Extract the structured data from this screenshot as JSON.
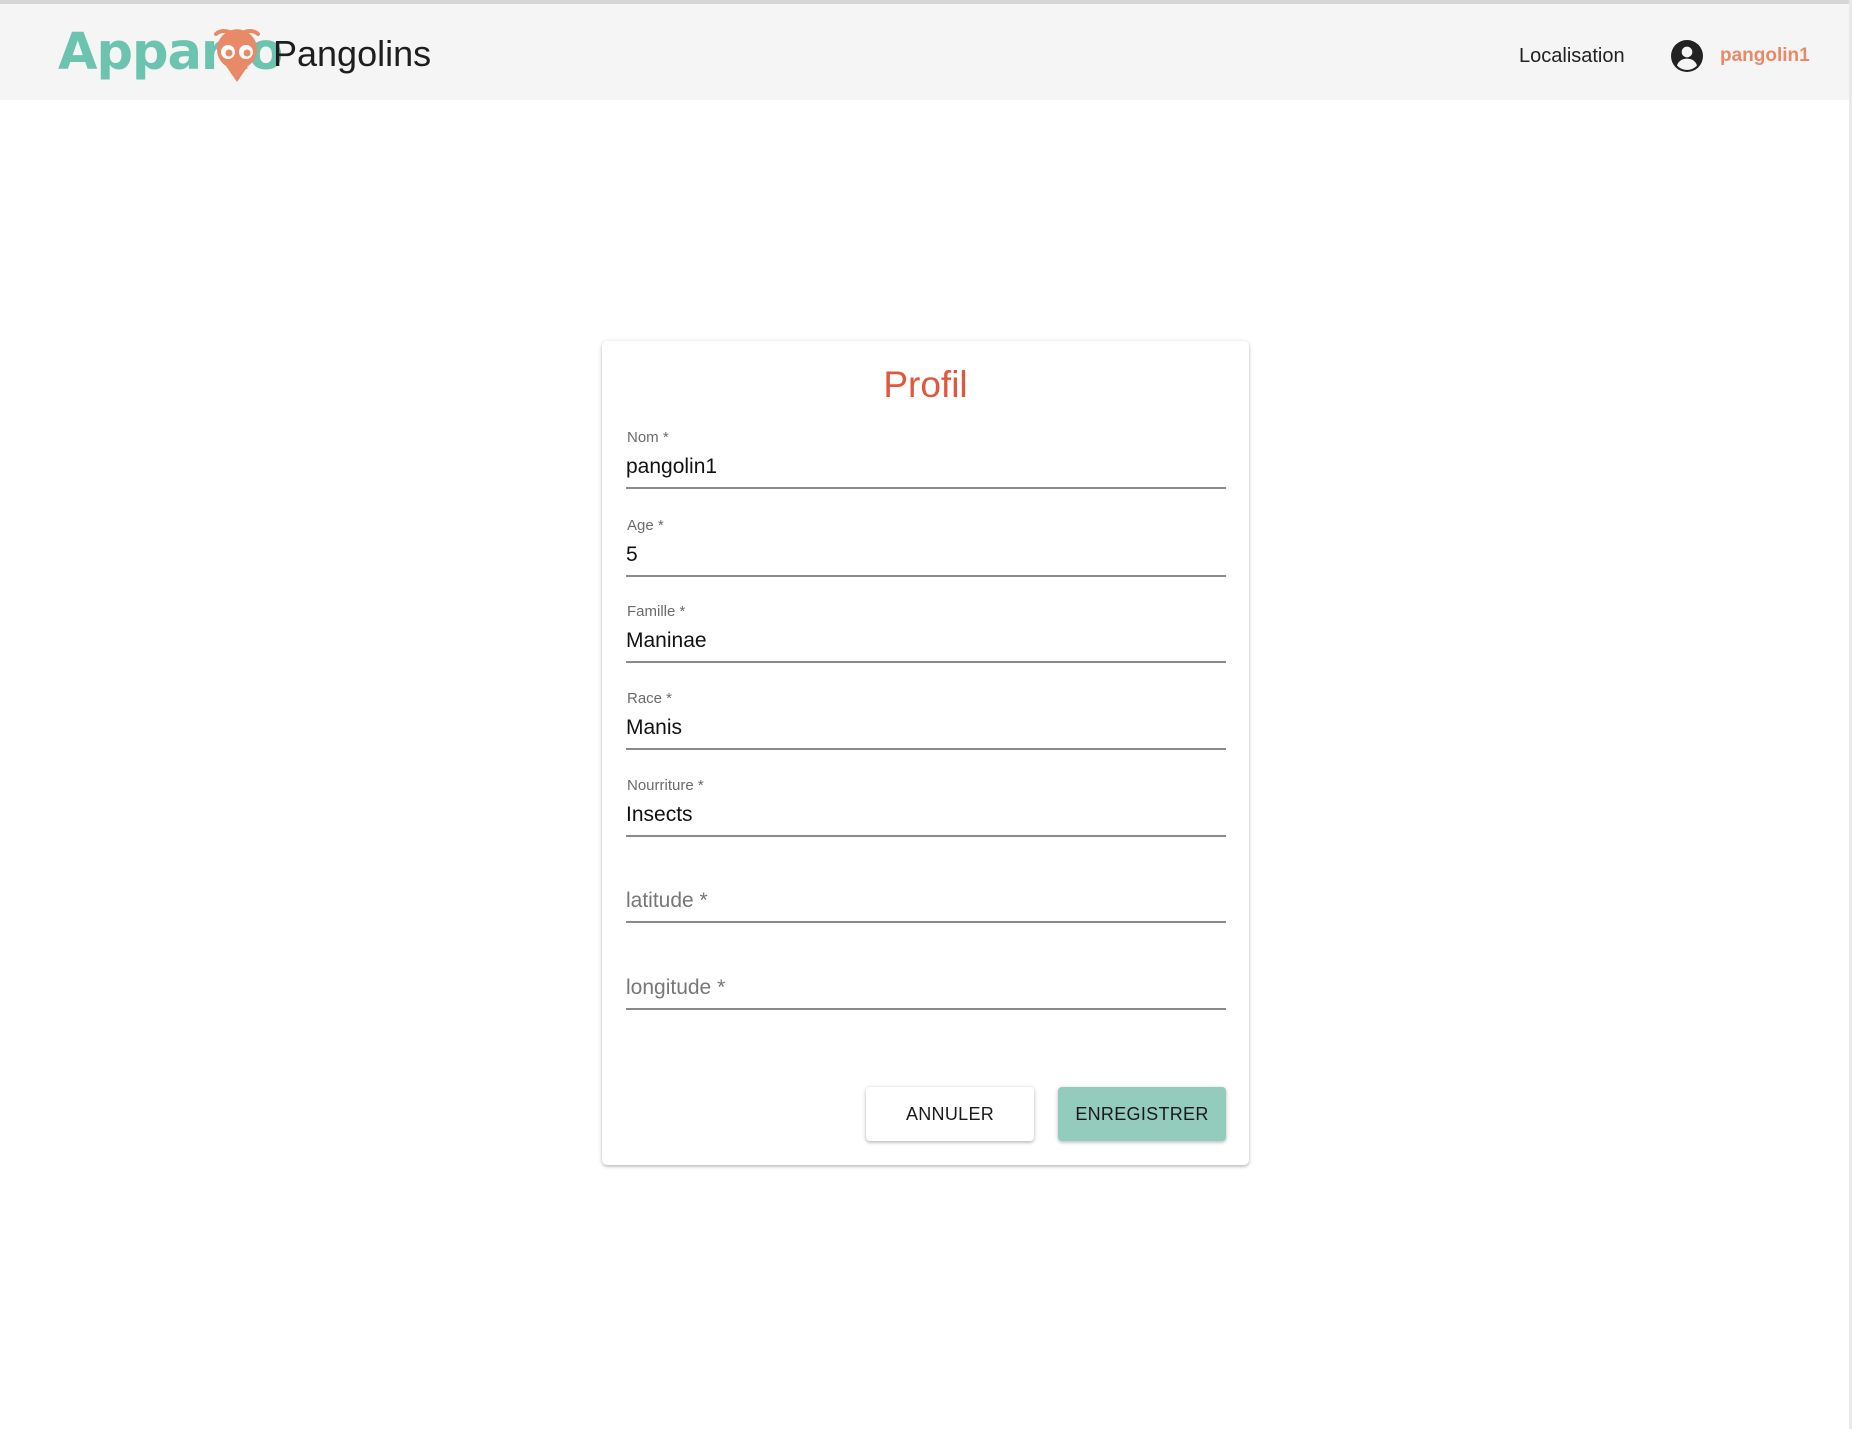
{
  "header": {
    "logo_text": "Apparto",
    "app_name": "Pangolins",
    "nav_localisation": "Localisation",
    "user_name": "pangolin1"
  },
  "colors": {
    "brand_teal": "#6cc4b0",
    "brand_coral": "#e88968",
    "title_red": "#e0573a",
    "save_button": "#93cbbc"
  },
  "icons": {
    "logo_mark": "location-pin-eyes-icon",
    "user": "account-circle-icon"
  },
  "form": {
    "title": "Profil",
    "fields": [
      {
        "label": "Nom *",
        "value": "pangolin1"
      },
      {
        "label": "Age *",
        "value": "5"
      },
      {
        "label": "Famille *",
        "value": "Maninae"
      },
      {
        "label": "Race *",
        "value": "Manis"
      },
      {
        "label": "Nourriture *",
        "value": "Insects"
      },
      {
        "placeholder": "latitude *",
        "value": ""
      },
      {
        "placeholder": "longitude *",
        "value": ""
      }
    ],
    "cancel_label": "ANNULER",
    "save_label": "ENREGISTRER"
  }
}
